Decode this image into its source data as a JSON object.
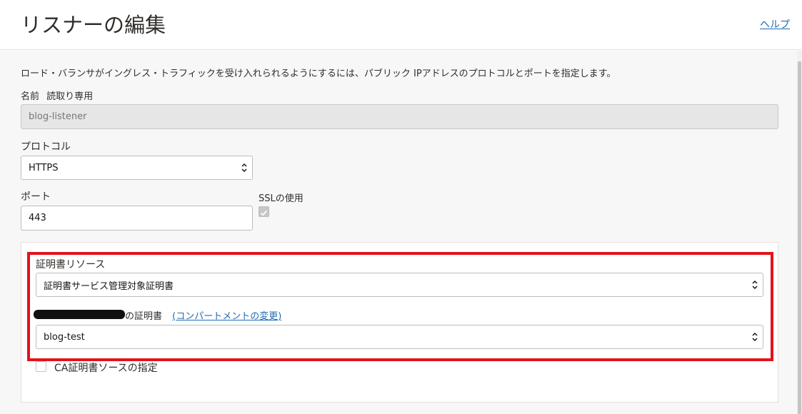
{
  "header": {
    "title": "リスナーの編集",
    "help_label": "ヘルプ"
  },
  "description": "ロード・バランサがイングレス・トラフィックを受け入れられるようにするには、パブリック IPアドレスのプロトコルとポートを指定します。",
  "name_field": {
    "label": "名前",
    "readonly_label": "読取り専用",
    "value": "blog-listener"
  },
  "protocol": {
    "label": "プロトコル",
    "value": "HTTPS"
  },
  "port": {
    "label": "ポート",
    "value": "443"
  },
  "ssl": {
    "label": "SSLの使用",
    "checked": true
  },
  "certificate": {
    "resource_label": "証明書リソース",
    "resource_value": "証明書サービス管理対象証明書",
    "cert_label_suffix": "の証明書",
    "change_compartment_label": "(コンパートメントの変更)",
    "cert_value": "blog-test"
  },
  "ca_cert": {
    "label": "CA証明書ソースの指定",
    "checked": false
  },
  "colors": {
    "accent": "#1e6bb5",
    "highlight": "#e1141c"
  }
}
